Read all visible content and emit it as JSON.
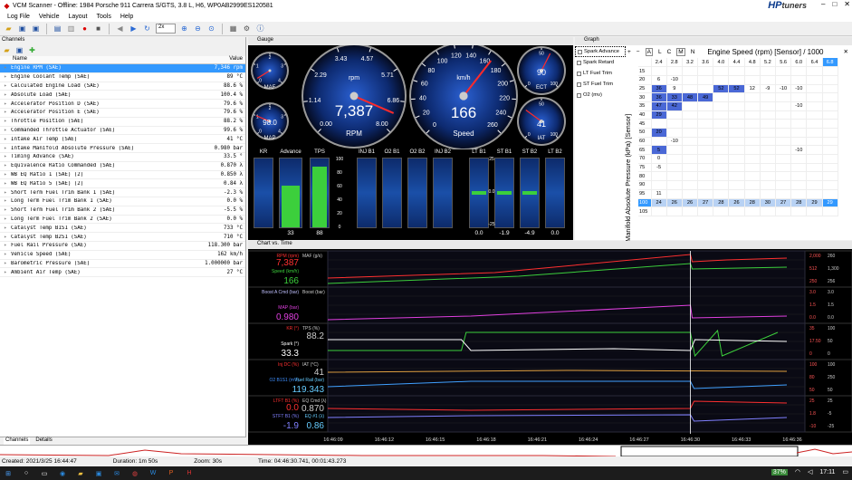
{
  "window": {
    "title": "VCM Scanner - Offline: 1984 Porsche 911 Carrera S/GTS, 3.8 L, H6, WP0AB2999ES120581",
    "logo": "HP",
    "logo_sub": "tuners",
    "controls": [
      "–",
      "□",
      "✕"
    ]
  },
  "menu": [
    "Log File",
    "Vehicle",
    "Layout",
    "Tools",
    "Help"
  ],
  "toolbar": {
    "zoom_value": "2x"
  },
  "channels": {
    "panel_title": "Channels",
    "col_name": "Name",
    "col_value": "Value",
    "rows": [
      {
        "name": "Engine RPM (SAE)",
        "value": "7,346 rpm",
        "selected": true
      },
      {
        "name": "Engine Coolant Temp (SAE)",
        "value": "89 °C"
      },
      {
        "name": "Calculated Engine Load (SAE)",
        "value": "88.6 %"
      },
      {
        "name": "Absolute Load (SAE)",
        "value": "100.4 %"
      },
      {
        "name": "Accelerator Position D (SAE)",
        "value": "79.6 %"
      },
      {
        "name": "Accelerator Position E (SAE)",
        "value": "79.6 %"
      },
      {
        "name": "Throttle Position (SAE)",
        "value": "88.2 %"
      },
      {
        "name": "Commanded Throttle Actuator (SAE)",
        "value": "99.6 %"
      },
      {
        "name": "Intake Air Temp (SAE)",
        "value": "41 °C"
      },
      {
        "name": "Intake Manifold Absolute Pressure (SAE)",
        "value": "0.980 bar"
      },
      {
        "name": "Timing Advance (SAE)",
        "value": "33.5 °"
      },
      {
        "name": "Equivalence Ratio Commanded (SAE)",
        "value": "0.870 λ"
      },
      {
        "name": "WB EQ Ratio 1 (SAE) (2)",
        "value": "0.850 λ"
      },
      {
        "name": "WB EQ Ratio 5 (SAE) (2)",
        "value": "0.84 λ"
      },
      {
        "name": "Short Term Fuel Trim Bank 1 (SAE)",
        "value": "-2.3 %"
      },
      {
        "name": "Long Term Fuel Trim Bank 1 (SAE)",
        "value": "0.0 %"
      },
      {
        "name": "Short Term Fuel Trim Bank 2 (SAE)",
        "value": "-5.5 %"
      },
      {
        "name": "Long Term Fuel Trim Bank 2 (SAE)",
        "value": "0.0 %"
      },
      {
        "name": "Catalyst Temp B1S1 (SAE)",
        "value": "733 °C"
      },
      {
        "name": "Catalyst Temp B2S1 (SAE)",
        "value": "710 °C"
      },
      {
        "name": "Fuel Rail Pressure (SAE)",
        "value": "118.300 bar"
      },
      {
        "name": "Vehicle Speed (SAE)",
        "value": "162 km/h"
      },
      {
        "name": "Barometric Pressure (SAE)",
        "value": "1.000000 bar"
      },
      {
        "name": "Ambient Air Temp (SAE)",
        "value": "27 °C"
      }
    ],
    "tabs": [
      "Channels",
      "Details"
    ]
  },
  "gauge_panel": {
    "title": "Gauge",
    "maf": {
      "label": "MAF",
      "ticks": [
        "0",
        "1",
        "2",
        "3",
        "4"
      ]
    },
    "map": {
      "label": "MAP",
      "value": "98.0",
      "ticks": [
        "0",
        "1",
        "2",
        "3",
        "4"
      ]
    },
    "rpm": {
      "label": "rpm",
      "name": "RPM",
      "value": "7,387",
      "ticks": [
        "0.00",
        "1.14",
        "2.29",
        "3.43",
        "4.57",
        "5.71",
        "6.86",
        "8.00"
      ]
    },
    "speed": {
      "label": "km/h",
      "name": "Speed",
      "value": "166",
      "ticks": [
        "0",
        "20",
        "40",
        "60",
        "80",
        "100",
        "120",
        "140",
        "160",
        "180",
        "200",
        "220",
        "240",
        "260"
      ]
    },
    "ect": {
      "label": "ECT",
      "value": "90",
      "ticks": [
        "0",
        "50",
        "100"
      ]
    },
    "iat": {
      "label": "IAT",
      "value": "41",
      "ticks": [
        "0",
        "50",
        "100"
      ]
    },
    "bars": [
      {
        "label": "KR",
        "value": "",
        "fill": 0
      },
      {
        "label": "Advance",
        "value": "33",
        "fill": 0.6
      },
      {
        "label": "TPS",
        "value": "88",
        "fill": 0.88
      },
      {
        "label": "INJ B1",
        "value": "",
        "fill": 0
      },
      {
        "label": "O2 B1",
        "value": "",
        "fill": 0
      },
      {
        "label": "O2 B2",
        "value": "",
        "fill": 0
      },
      {
        "label": "INJ B2",
        "value": "",
        "fill": 0
      },
      {
        "label": "LT B1",
        "value": "0.0",
        "fill": 0
      },
      {
        "label": "ST B1",
        "value": "-1.9",
        "fill": 0
      },
      {
        "label": "ST B2",
        "value": "-4.9",
        "fill": 0
      },
      {
        "label": "LT B2",
        "value": "0.0",
        "fill": 0
      }
    ],
    "tps_scale": [
      "100",
      "80",
      "60",
      "40",
      "20",
      "0"
    ],
    "trim_scale": [
      "25",
      "0.0",
      "-25"
    ]
  },
  "graph_panel": {
    "title": "Graph",
    "tables": [
      "Spark Advance",
      "Spark Retard",
      "LT Fuel Trim",
      "ST Fuel Trim",
      "O2 (mv)"
    ],
    "table_title": "Engine Speed (rpm) [Sensor] / 1000",
    "y_axis": "Manifold Absolute Pressure (kPa) [Sensor]",
    "toolbar": [
      "+",
      "−",
      "A",
      "L",
      "C",
      "M",
      "N"
    ],
    "columns": [
      "2.4",
      "2.8",
      "3.2",
      "3.6",
      "4.0",
      "4.4",
      "4.8",
      "5.2",
      "5.6",
      "6.0",
      "6.4",
      "6.8"
    ],
    "rows": [
      {
        "kpa": "15",
        "cells": [
          "",
          "",
          "",
          "",
          "",
          "",
          "",
          "",
          "",
          "",
          "",
          ""
        ]
      },
      {
        "kpa": "20",
        "cells": [
          "6",
          "-10",
          "",
          "",
          "",
          "",
          "",
          "",
          "",
          "",
          "",
          ""
        ]
      },
      {
        "kpa": "25",
        "cells": [
          "36",
          "9",
          "",
          "",
          "52",
          "52",
          "12",
          "-9",
          "-10",
          "-10",
          "",
          ""
        ]
      },
      {
        "kpa": "30",
        "cells": [
          "36",
          "33",
          "48",
          "49",
          "",
          "",
          "",
          "",
          "",
          "",
          "",
          ""
        ]
      },
      {
        "kpa": "35",
        "cells": [
          "47",
          "42",
          "",
          "",
          "",
          "",
          "",
          "",
          "",
          "-10",
          "",
          ""
        ]
      },
      {
        "kpa": "40",
        "cells": [
          "29",
          "",
          "",
          "",
          "",
          "",
          "",
          "",
          "",
          "",
          "",
          ""
        ]
      },
      {
        "kpa": "45",
        "cells": [
          "",
          "",
          "",
          "",
          "",
          "",
          "",
          "",
          "",
          "",
          "",
          ""
        ]
      },
      {
        "kpa": "50",
        "cells": [
          "20",
          "",
          "",
          "",
          "",
          "",
          "",
          "",
          "",
          "",
          "",
          ""
        ]
      },
      {
        "kpa": "60",
        "cells": [
          "",
          "-10",
          "",
          "",
          "",
          "",
          "",
          "",
          "",
          "",
          "",
          ""
        ]
      },
      {
        "kpa": "65",
        "cells": [
          "5",
          "",
          "",
          "",
          "",
          "",
          "",
          "",
          "",
          "-10",
          "",
          ""
        ]
      },
      {
        "kpa": "70",
        "cells": [
          "0",
          "",
          "",
          "",
          "",
          "",
          "",
          "",
          "",
          "",
          "",
          ""
        ]
      },
      {
        "kpa": "75",
        "cells": [
          "-5",
          "",
          "",
          "",
          "",
          "",
          "",
          "",
          "",
          "",
          "",
          ""
        ]
      },
      {
        "kpa": "80",
        "cells": [
          "",
          "",
          "",
          "",
          "",
          "",
          "",
          "",
          "",
          "",
          "",
          ""
        ]
      },
      {
        "kpa": "90",
        "cells": [
          "",
          "",
          "",
          "",
          "",
          "",
          "",
          "",
          "",
          "",
          "",
          ""
        ]
      },
      {
        "kpa": "95",
        "cells": [
          "11",
          "",
          "",
          "",
          "",
          "",
          "",
          "",
          "",
          "",
          "",
          ""
        ]
      },
      {
        "kpa": "100",
        "cells": [
          "24",
          "26",
          "26",
          "27",
          "28",
          "26",
          "28",
          "30",
          "27",
          "28",
          "29",
          "29"
        ],
        "current": true
      },
      {
        "kpa": "105",
        "cells": [
          "",
          "",
          "",
          "",
          "",
          "",
          "",
          "",
          "",
          "",
          "",
          ""
        ]
      }
    ]
  },
  "chart_panel": {
    "title": "Chart vs. Time",
    "lanes": [
      {
        "left_label": "RPM (rpm)",
        "left_value": "7,387",
        "left_color": "#ff3030",
        "left2_label": "Speed (km/h)",
        "left2_value": "166",
        "left2_color": "#3ccf3c",
        "mid_label": "MAF (g/s)",
        "right": [
          "2,000",
          "260",
          "512",
          "1,300",
          "250",
          "256"
        ]
      },
      {
        "left_label": "Boost A Cmd (bar)",
        "left_value": "",
        "left_color": "#c0c0ff",
        "left2_label": "MAP (bar)",
        "left2_value": "0.980",
        "left2_color": "#e040e0",
        "mid_label": "Boost (bar)",
        "right": [
          "3.0",
          "3.0",
          "1.5",
          "1.5",
          "0.0",
          "0.0"
        ]
      },
      {
        "left_label": "KR (°)",
        "left_value": "",
        "left_color": "#ff3030",
        "left2_label": "Spark (°)",
        "left2_value": "33.3",
        "left2_color": "#ffffff",
        "mid_label": "TPS (%)",
        "mid_value": "88.2",
        "right": [
          "35",
          "100",
          "17.50",
          "50",
          "0",
          "0"
        ]
      },
      {
        "left_label": "Inj DC (%)",
        "left_value": "",
        "left_color": "#ff3030",
        "left2_label": "O2 B1S1 (mV)",
        "left2_value": "",
        "left2_color": "#4090ff",
        "mid_label": "IAT (°C)",
        "mid_value": "41",
        "mid2_label": "Fuel Rail (bar)",
        "mid2_value": "119.343",
        "right": [
          "100",
          "100",
          "80",
          "250",
          "50",
          "50"
        ]
      },
      {
        "left_label": "LTFT B1 (%)",
        "left_value": "0.0",
        "left_color": "#ff3030",
        "left2_label": "STFT B1 (%)",
        "left2_value": "-1.9",
        "left2_color": "#8080ff",
        "mid_label": "EQ Cmd (λ)",
        "mid_value": "0.870",
        "mid2_label": "EQ #1 (λ)",
        "mid2_value": "0.86",
        "right": [
          "25",
          "25",
          "1.8",
          "-5",
          "-10",
          "-25"
        ]
      }
    ],
    "times": [
      "16:46:09",
      "16:46:12",
      "16:46:15",
      "16:46:18",
      "16:46:21",
      "16:46:24",
      "16:46:27",
      "16:46:30",
      "16:46:33",
      "16:46:36"
    ]
  },
  "status": {
    "created": "Created: 2021/3/25 16:44:47",
    "duration": "Duration: 1m 50s",
    "zoom": "Zoom: 30s",
    "time": "Time: 04:46:30.741, 00:01:43.273"
  },
  "taskbar": {
    "battery": "37%",
    "clock": "17:11"
  }
}
